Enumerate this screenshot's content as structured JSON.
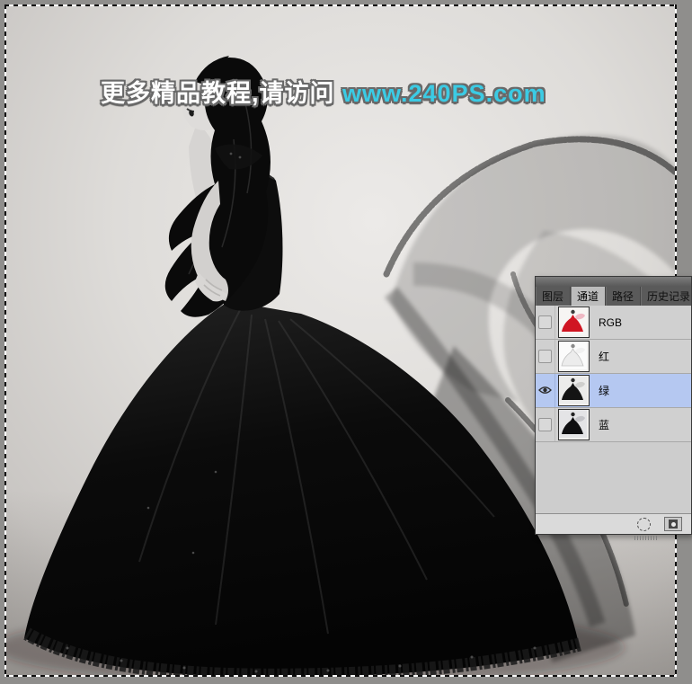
{
  "watermark": {
    "text_prefix": "更多精品教程,请访问 ",
    "url": "www.240PS.com"
  },
  "colors": {
    "url_cyan": "#3bcbe4",
    "selected_row_blue": "#b5c8f1",
    "rgb_thumbnail_dress_red": "#d01522",
    "canvas_background_gray": "#dcdad7",
    "panel_tab_dark_gray": "#5a5a5a"
  },
  "canvas": {
    "selection_active": true,
    "photo_description": "grayscale photo of woman in long black ball gown with flowing black veil"
  },
  "panel": {
    "tabs": [
      {
        "label": "图层"
      },
      {
        "label": "通道"
      },
      {
        "label": "路径"
      },
      {
        "label": "历史记录"
      }
    ],
    "active_tab": "通道",
    "channels": [
      {
        "name": "RGB"
      },
      {
        "name": "红"
      },
      {
        "name": "绿"
      },
      {
        "name": "蓝"
      }
    ],
    "selected_channel": "绿",
    "visible_channel": "绿",
    "footer_icons": [
      "load-channel-as-selection",
      "panel-options-button"
    ]
  }
}
